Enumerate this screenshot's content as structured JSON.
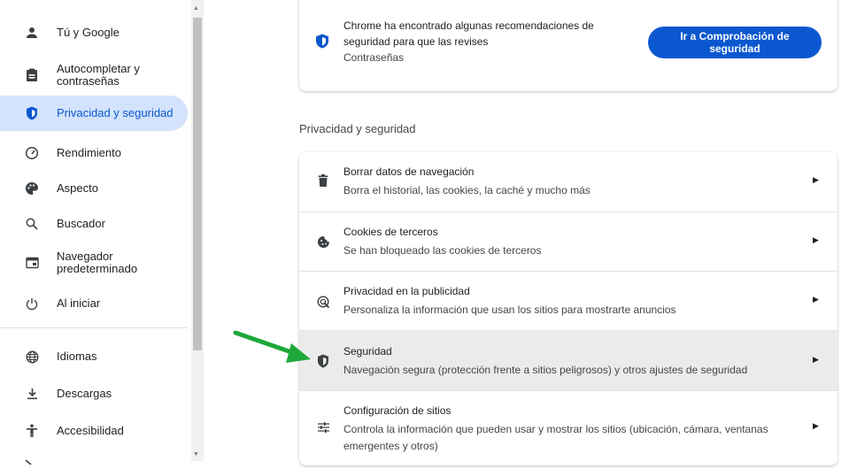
{
  "sidebar": {
    "items": [
      {
        "label": "Tú y Google",
        "icon": "person-icon"
      },
      {
        "label": "Autocompletar y\ncontraseñas",
        "icon": "clipboard-icon"
      },
      {
        "label": "Privacidad y seguridad",
        "icon": "shield-icon",
        "active": true
      },
      {
        "label": "Rendimiento",
        "icon": "speedometer-icon"
      },
      {
        "label": "Aspecto",
        "icon": "palette-icon"
      },
      {
        "label": "Buscador",
        "icon": "search-icon"
      },
      {
        "label": "Navegador\npredeterminado",
        "icon": "browser-icon"
      },
      {
        "label": "Al iniciar",
        "icon": "power-icon"
      },
      {
        "label": "Idiomas",
        "icon": "globe-icon"
      },
      {
        "label": "Descargas",
        "icon": "download-icon"
      },
      {
        "label": "Accesibilidad",
        "icon": "accessibility-icon"
      }
    ]
  },
  "recommendation": {
    "line1": "Chrome ha encontrado algunas recomendaciones de",
    "line2": "seguridad para que las revises",
    "sub": "Contraseñas",
    "button": "Ir a Comprobación de seguridad"
  },
  "section_title": "Privacidad y seguridad",
  "settings": [
    {
      "title": "Borrar datos de navegación",
      "desc": "Borra el historial, las cookies, la caché y mucho más",
      "icon": "trash-icon"
    },
    {
      "title": "Cookies de terceros",
      "desc": "Se han bloqueado las cookies de terceros",
      "icon": "cookie-icon"
    },
    {
      "title": "Privacidad en la publicidad",
      "desc": "Personaliza la información que usan los sitios para mostrarte anuncios",
      "icon": "ad-privacy-icon"
    },
    {
      "title": "Seguridad",
      "desc": "Navegación segura (protección frente a sitios peligrosos) y otros ajustes de seguridad",
      "icon": "shield-icon",
      "hovered": true
    },
    {
      "title": "Configuración de sitios",
      "desc": "Controla la información que pueden usar y mostrar los sitios (ubicación, cámara, ventanas\nemergentes y otros)",
      "icon": "tune-icon"
    }
  ],
  "colors": {
    "accent": "#0b57d0",
    "active_bg": "#d3e3fd",
    "hover_row": "#ebebeb",
    "arrow": "#1ea83a"
  }
}
